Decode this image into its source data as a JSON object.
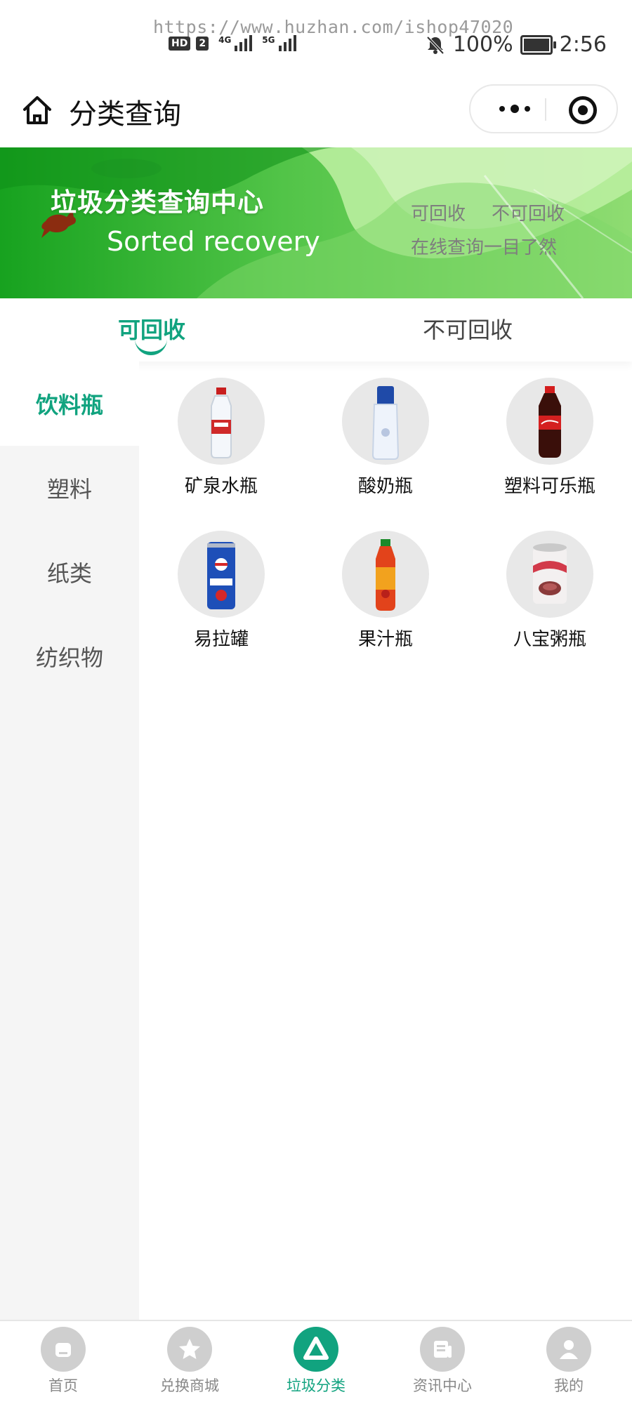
{
  "status_bar": {
    "watermark": "https://www.huzhan.com/ishop47020",
    "hd": "HD",
    "sim": "2",
    "net1": "4G",
    "net2": "5G",
    "battery": "100%",
    "time": "2:56",
    "icons": [
      "bell-muted-icon",
      "battery-charging-icon"
    ]
  },
  "header": {
    "title": "分类查询",
    "icons": [
      "home-icon",
      "more-icon",
      "target-icon"
    ]
  },
  "banner": {
    "title": "垃圾分类查询中心",
    "subtitle": "Sorted recovery",
    "tag_recyclable": "可回收",
    "tag_non_recyclable": "不可回收",
    "tagline": "在线查询一目了然",
    "colors": {
      "dark_green": "#1a9d26",
      "light_green": "#b8ee9e"
    }
  },
  "tabs": [
    {
      "label": "可回收",
      "active": true
    },
    {
      "label": "不可回收",
      "active": false
    }
  ],
  "sidebar": {
    "items": [
      {
        "label": "饮料瓶",
        "active": true
      },
      {
        "label": "塑料",
        "active": false
      },
      {
        "label": "纸类",
        "active": false
      },
      {
        "label": "纺织物",
        "active": false
      }
    ]
  },
  "items": [
    {
      "label": "矿泉水瓶",
      "icon": "water-bottle-icon"
    },
    {
      "label": "酸奶瓶",
      "icon": "yogurt-bottle-icon"
    },
    {
      "label": "塑料可乐瓶",
      "icon": "cola-bottle-icon"
    },
    {
      "label": "易拉罐",
      "icon": "can-icon"
    },
    {
      "label": "果汁瓶",
      "icon": "juice-bottle-icon"
    },
    {
      "label": "八宝粥瓶",
      "icon": "porridge-can-icon"
    }
  ],
  "tabbar": [
    {
      "label": "首页",
      "icon": "home-icon",
      "active": false
    },
    {
      "label": "兑换商城",
      "icon": "star-icon",
      "active": false
    },
    {
      "label": "垃圾分类",
      "icon": "recycle-icon",
      "active": true
    },
    {
      "label": "资讯中心",
      "icon": "news-icon",
      "active": false
    },
    {
      "label": "我的",
      "icon": "user-icon",
      "active": false
    }
  ],
  "accent_color": "#11a37f"
}
